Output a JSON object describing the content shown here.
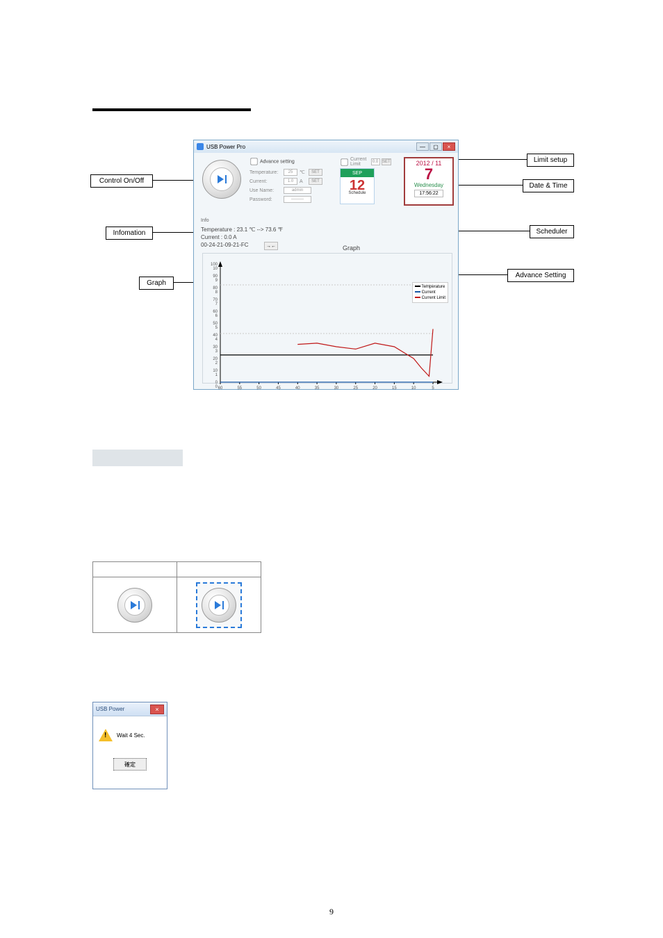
{
  "callouts": {
    "control": "Control On/Off",
    "information": "Infomation",
    "graph": "Graph",
    "limit": "Limit setup",
    "datetime": "Date & Time",
    "scheduler": "Scheduler",
    "advance": "Advance Setting"
  },
  "app": {
    "title": "USB Power Pro",
    "advance": {
      "heading": "Advance setting",
      "temperature_label": "Temperature:",
      "temperature_value": "25",
      "temperature_unit": "℃",
      "current_label": "Current:",
      "current_value": "1.0",
      "current_unit": "A",
      "username_label": "Use Name:",
      "username_value": "admin",
      "password_label": "Password:",
      "password_value": "———",
      "set_button": "SET"
    },
    "limit": {
      "label": "Current Limit",
      "value": "0.0",
      "set_button": "SET"
    },
    "schedule": {
      "month": "SEP",
      "day": "12",
      "label": "Schedule"
    },
    "datetime": {
      "date": "2012 / 11",
      "big": "7",
      "weekday": "Wednesday",
      "time": "17:56:22"
    },
    "info": {
      "heading": "Info",
      "temperature": "Temperature : 23.1 ℃ --> 73.6 ℉",
      "current": "Current : 0.0 A",
      "mac": "00-24-21-09-21-FC",
      "refresh": "→←"
    },
    "graph_label": "Graph",
    "legend": {
      "a": "Temperature",
      "b": "Current",
      "c": "Current Limit"
    }
  },
  "chart_data": {
    "type": "line",
    "title": "",
    "xlabel": "",
    "ylabel": "",
    "x_ticks": [
      60,
      55,
      50,
      45,
      40,
      35,
      30,
      25,
      20,
      15,
      10,
      5
    ],
    "y_left_ticks": [
      0,
      10,
      20,
      30,
      40,
      50,
      60,
      70,
      80,
      90,
      100
    ],
    "y_right_ticks": [
      0,
      1,
      2,
      3,
      4,
      5,
      6,
      7,
      8,
      9,
      10
    ],
    "ylim_left": [
      0,
      100
    ],
    "ylim_right": [
      0,
      10
    ],
    "series": [
      {
        "name": "Temperature",
        "color": "#000000",
        "x": [
          60,
          55,
          50,
          45,
          40,
          35,
          30,
          25,
          20,
          15,
          10,
          5
        ],
        "y": [
          23,
          23,
          23,
          23,
          23,
          23,
          23,
          23,
          23,
          23,
          23,
          23
        ]
      },
      {
        "name": "Current",
        "color": "#1757a5",
        "x": [
          60,
          55,
          50,
          45,
          40,
          35,
          30,
          25,
          20,
          15,
          10,
          5
        ],
        "y": [
          0,
          0,
          0,
          0,
          0,
          0,
          0,
          0,
          0,
          0,
          0,
          0
        ]
      },
      {
        "name": "Current Limit",
        "color": "#c01818",
        "x": [
          40,
          35,
          30,
          25,
          20,
          15,
          10,
          8,
          6,
          5
        ],
        "y": [
          32,
          33,
          30,
          28,
          33,
          30,
          20,
          12,
          5,
          45
        ]
      }
    ]
  },
  "wait_dialog": {
    "title": "USB Power",
    "message": "Wait  4 Sec.",
    "ok": "確定"
  },
  "page_number": "9"
}
